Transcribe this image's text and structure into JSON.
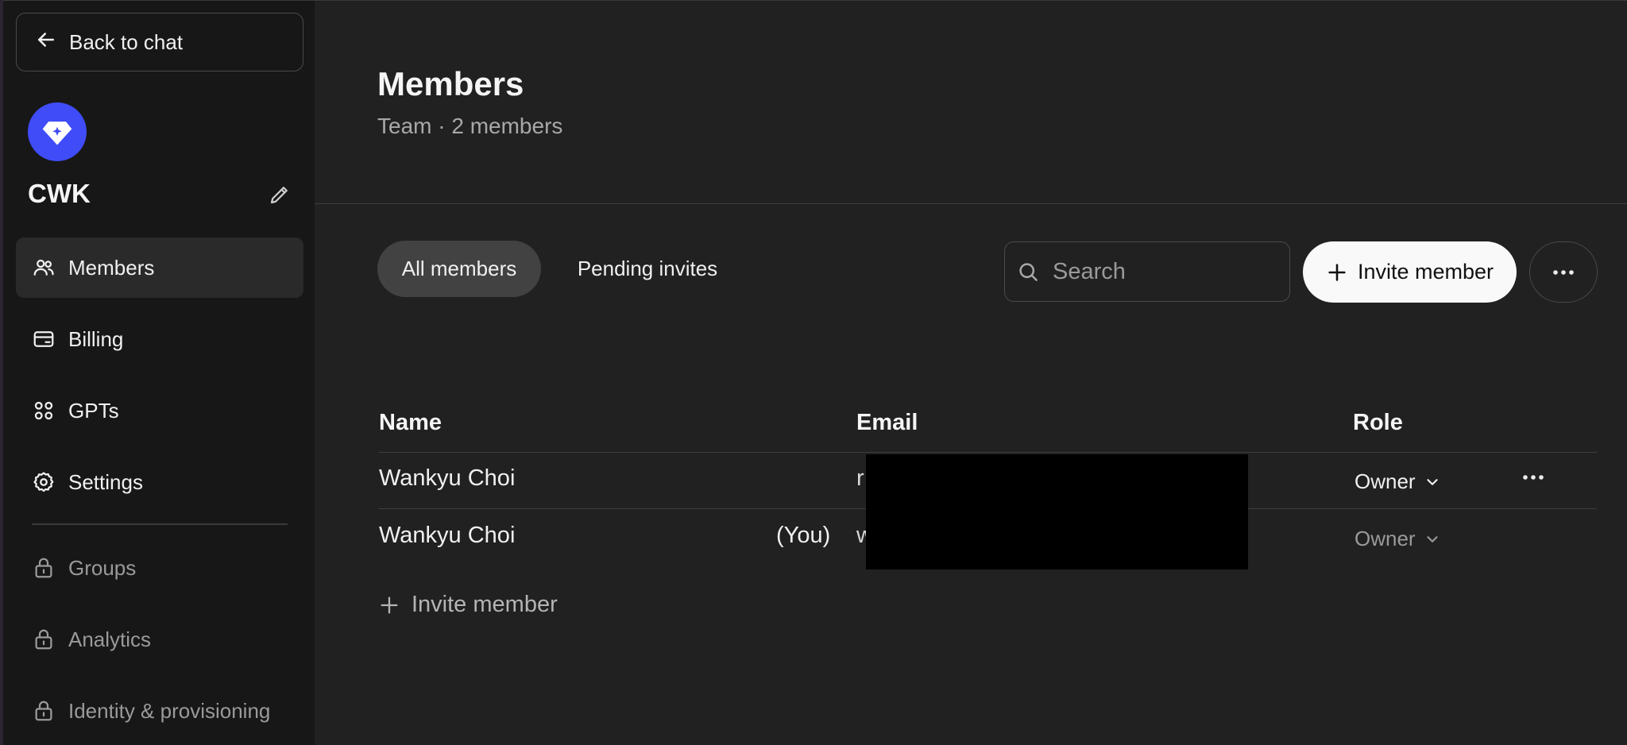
{
  "sidebar": {
    "back_label": "Back to chat",
    "workspace_name": "CWK",
    "items": [
      {
        "label": "Members"
      },
      {
        "label": "Billing"
      },
      {
        "label": "GPTs"
      },
      {
        "label": "Settings"
      }
    ],
    "locked_items": [
      {
        "label": "Groups"
      },
      {
        "label": "Analytics"
      },
      {
        "label": "Identity & provisioning"
      }
    ]
  },
  "header": {
    "title": "Members",
    "subtitle": "Team · 2 members"
  },
  "tabs": [
    {
      "label": "All members"
    },
    {
      "label": "Pending invites"
    }
  ],
  "search": {
    "placeholder": "Search"
  },
  "toolbar": {
    "invite_label": "Invite member"
  },
  "table": {
    "columns": [
      "Name",
      "Email",
      "Role"
    ],
    "rows": [
      {
        "name": "Wankyu Choi",
        "you": "",
        "email": "r",
        "role": "Owner"
      },
      {
        "name": "Wankyu Choi",
        "you": "(You)",
        "email": "w",
        "role": "Owner"
      }
    ]
  },
  "footer": {
    "invite_label": "Invite member"
  },
  "colors": {
    "accent": "#3f4cf7",
    "background": "#212121",
    "sidebar": "#171717"
  }
}
